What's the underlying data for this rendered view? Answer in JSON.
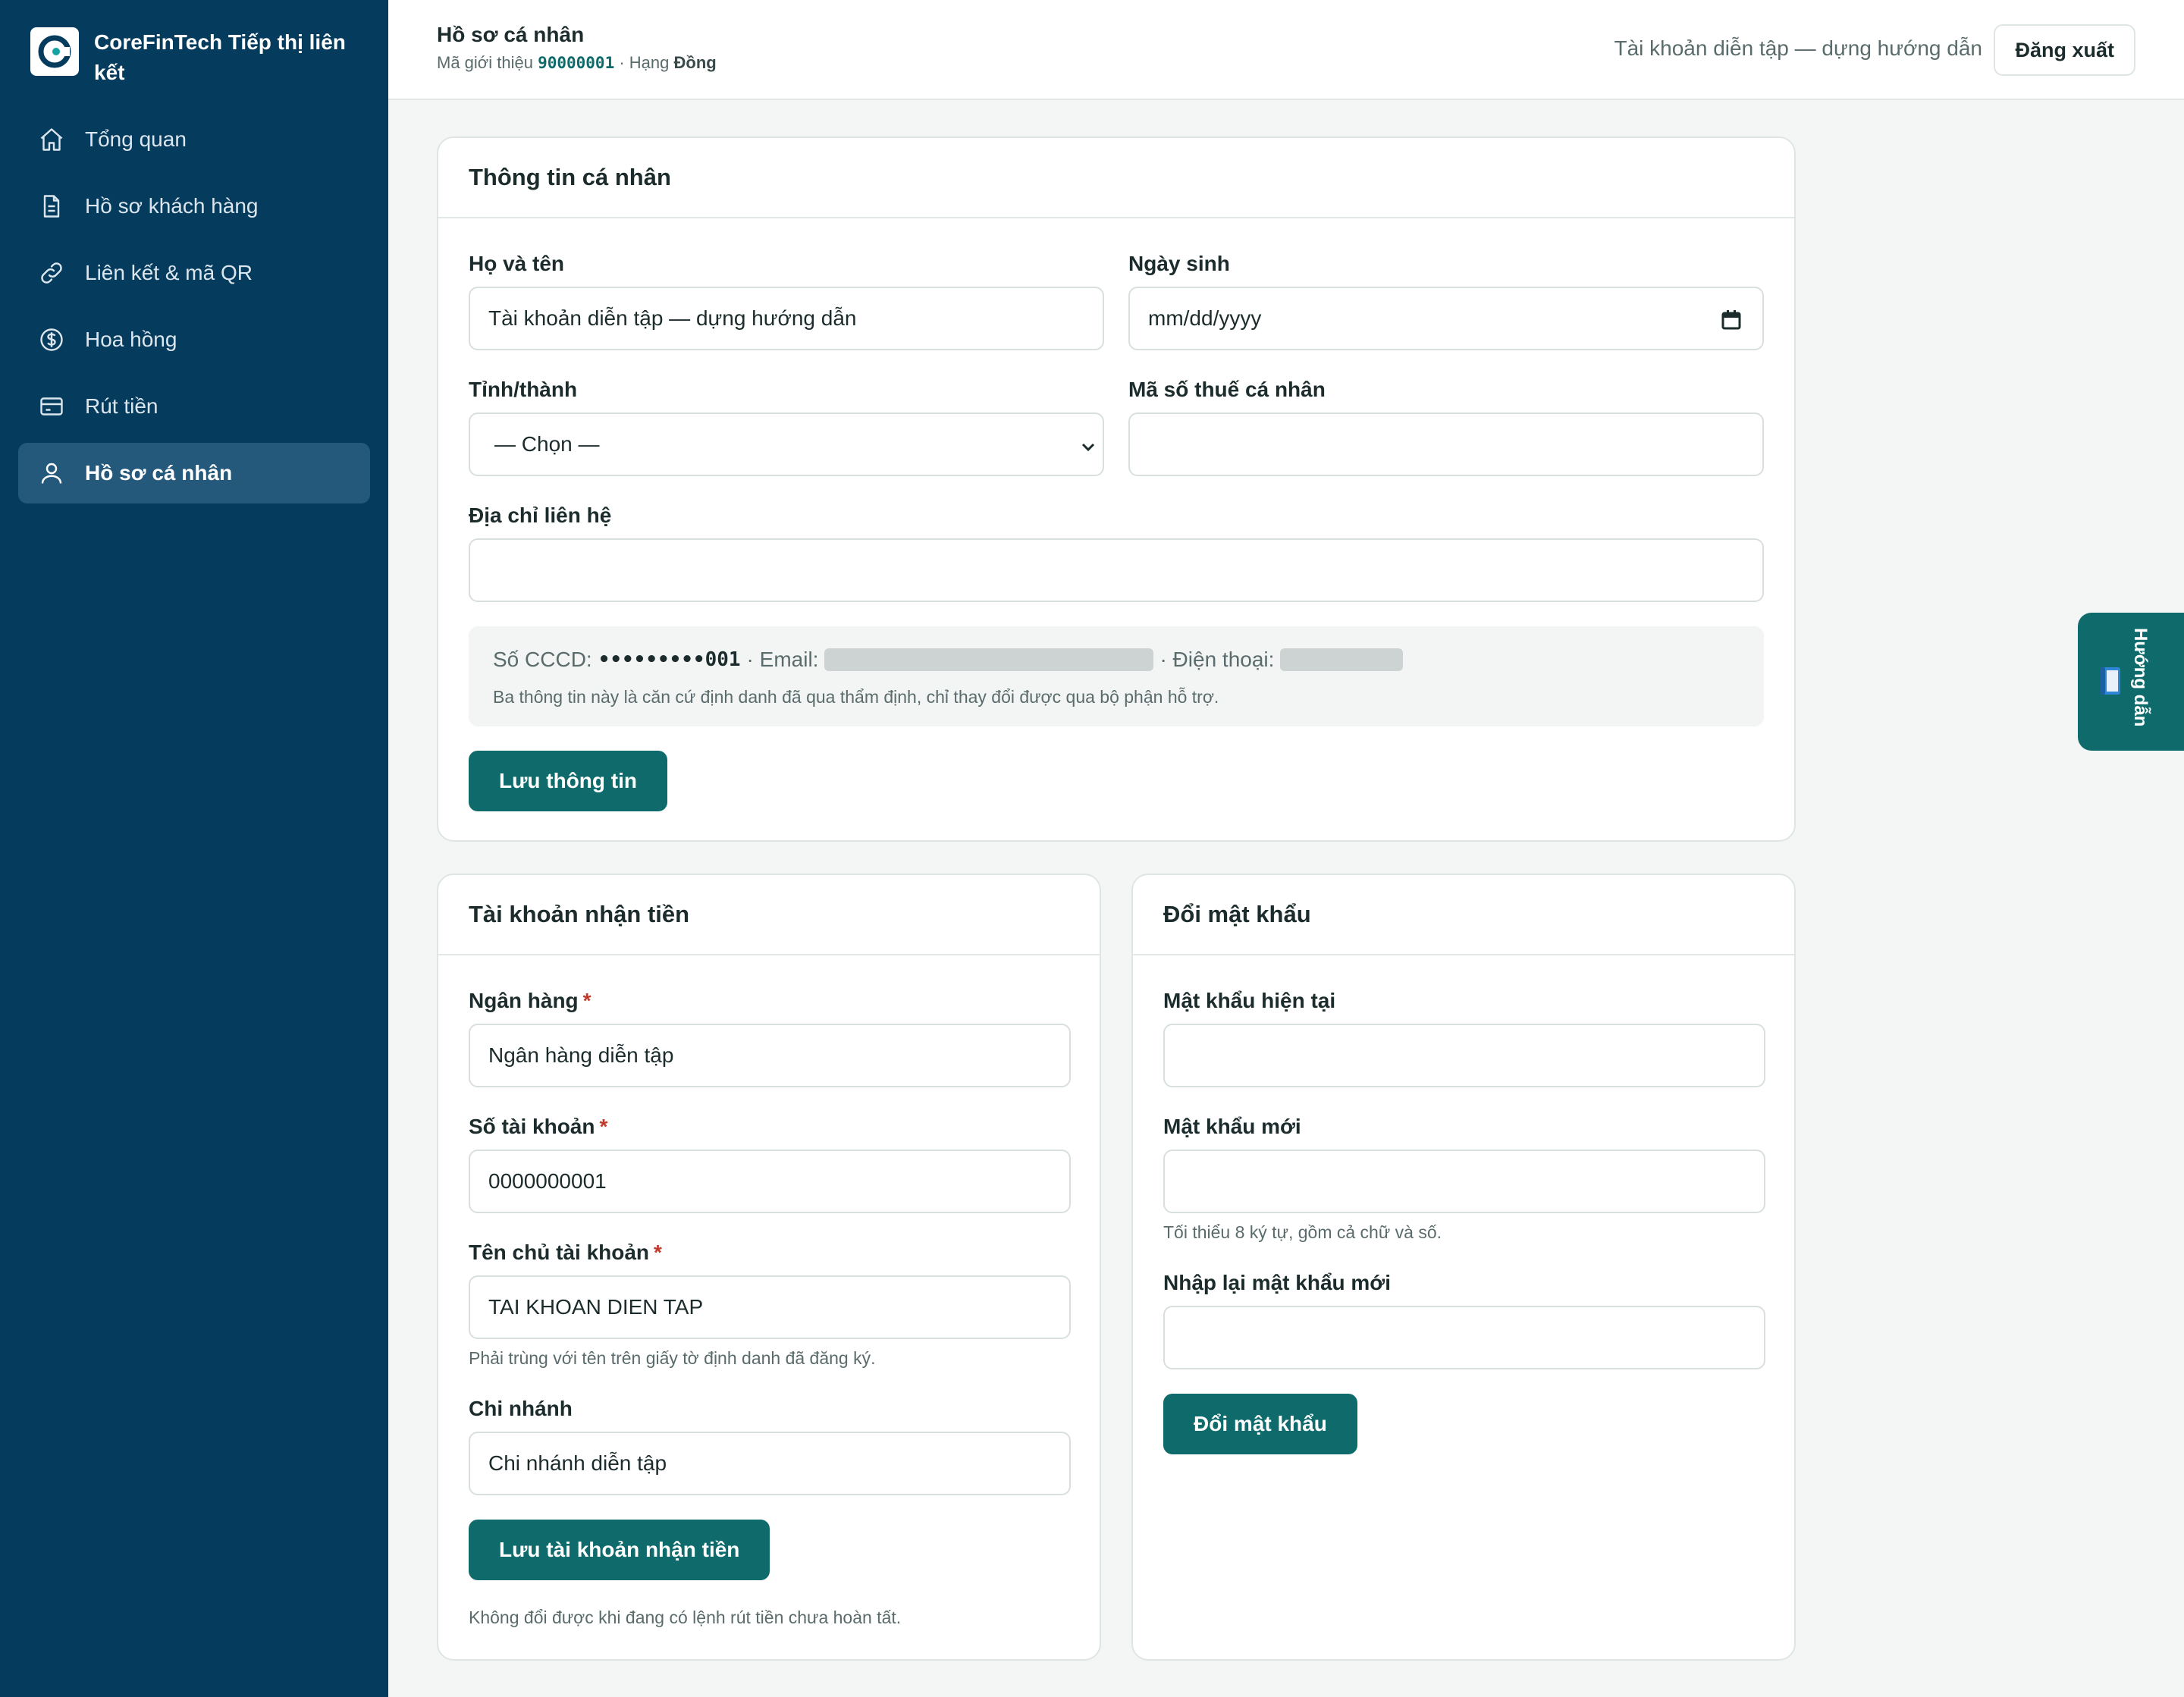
{
  "app": {
    "brand_name": "CoreFinTech Tiếp thị liên kết",
    "colors": {
      "sidebar": "#053b5c",
      "accent": "#0f6b6b",
      "active_nav": "#24597b"
    }
  },
  "sidebar": {
    "items": [
      {
        "label": "Tổng quan",
        "icon": "home-icon"
      },
      {
        "label": "Hồ sơ khách hàng",
        "icon": "document-icon"
      },
      {
        "label": "Liên kết & mã QR",
        "icon": "link-icon"
      },
      {
        "label": "Hoa hồng",
        "icon": "dollar-icon"
      },
      {
        "label": "Rút tiền",
        "icon": "card-icon"
      },
      {
        "label": "Hồ sơ cá nhân",
        "icon": "user-icon",
        "active": true
      }
    ]
  },
  "header": {
    "title": "Hồ sơ cá nhân",
    "referral_prefix": "Mã giới thiệu",
    "referral_code": "90000001",
    "rank_prefix": "· Hạng",
    "rank": "Đồng",
    "user_name": "Tài khoản diễn tập — dựng hướng dẫn",
    "logout_label": "Đăng xuất"
  },
  "personal": {
    "title": "Thông tin cá nhân",
    "fullname_label": "Họ và tên",
    "fullname_value": "Tài khoản diễn tập — dựng hướng dẫn",
    "dob_label": "Ngày sinh",
    "dob_placeholder": "mm/dd/yyyy",
    "province_label": "Tỉnh/thành",
    "province_value": "— Chọn —",
    "tax_label": "Mã số thuế cá nhân",
    "tax_value": "",
    "address_label": "Địa chỉ liên hệ",
    "address_value": "",
    "id_prefix": "Số CCCD:",
    "id_masked": "•••••••••001",
    "email_prefix": "· Email:",
    "phone_prefix": "· Điện thoại:",
    "id_note": "Ba thông tin này là căn cứ định danh đã qua thẩm định, chỉ thay đổi được qua bộ phận hỗ trợ.",
    "save_label": "Lưu thông tin"
  },
  "bank": {
    "title": "Tài khoản nhận tiền",
    "bank_label": "Ngân hàng",
    "bank_value": "Ngân hàng diễn tập",
    "account_label": "Số tài khoản",
    "account_value": "0000000001",
    "holder_label": "Tên chủ tài khoản",
    "holder_value": "TAI KHOAN DIEN TAP",
    "holder_help": "Phải trùng với tên trên giấy tờ định danh đã đăng ký.",
    "branch_label": "Chi nhánh",
    "branch_value": "Chi nhánh diễn tập",
    "save_label": "Lưu tài khoản nhận tiền",
    "note": "Không đổi được khi đang có lệnh rút tiền chưa hoàn tất.",
    "required_mark": "*"
  },
  "password": {
    "title": "Đổi mật khẩu",
    "current_label": "Mật khẩu hiện tại",
    "new_label": "Mật khẩu mới",
    "new_help": "Tối thiểu 8 ký tự, gồm cả chữ và số.",
    "confirm_label": "Nhập lại mật khẩu mới",
    "submit_label": "Đổi mật khẩu"
  },
  "guide": {
    "label": "Hướng dẫn",
    "icon": "book-icon"
  }
}
